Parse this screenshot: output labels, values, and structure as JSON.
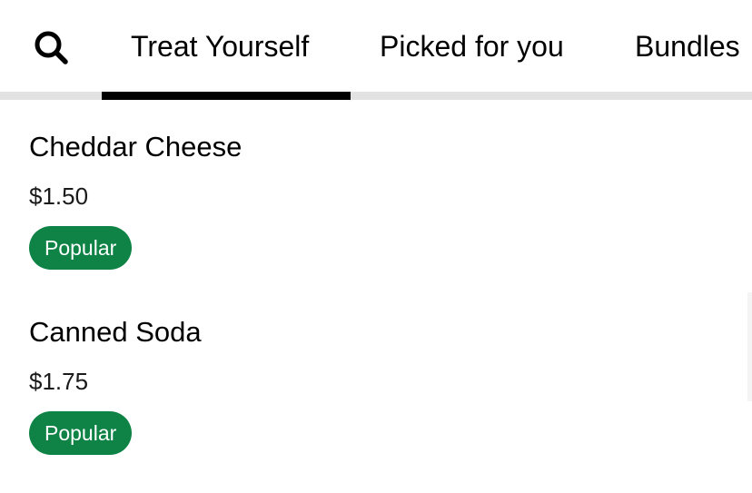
{
  "tabs": {
    "items": [
      {
        "label": "Treat Yourself",
        "selected": true
      },
      {
        "label": "Picked for you",
        "selected": false
      },
      {
        "label": "Bundles",
        "selected": false
      }
    ]
  },
  "icons": {
    "search": "search-icon"
  },
  "menu": {
    "items": [
      {
        "name": "Cheddar Cheese",
        "price": "$1.50",
        "badge": "Popular"
      },
      {
        "name": "Canned Soda",
        "price": "$1.75",
        "badge": "Popular"
      }
    ]
  },
  "colors": {
    "accent_tab": "#000000",
    "track": "#e2e2e2",
    "badge_bg": "#0e8345",
    "badge_text": "#ffffff"
  }
}
